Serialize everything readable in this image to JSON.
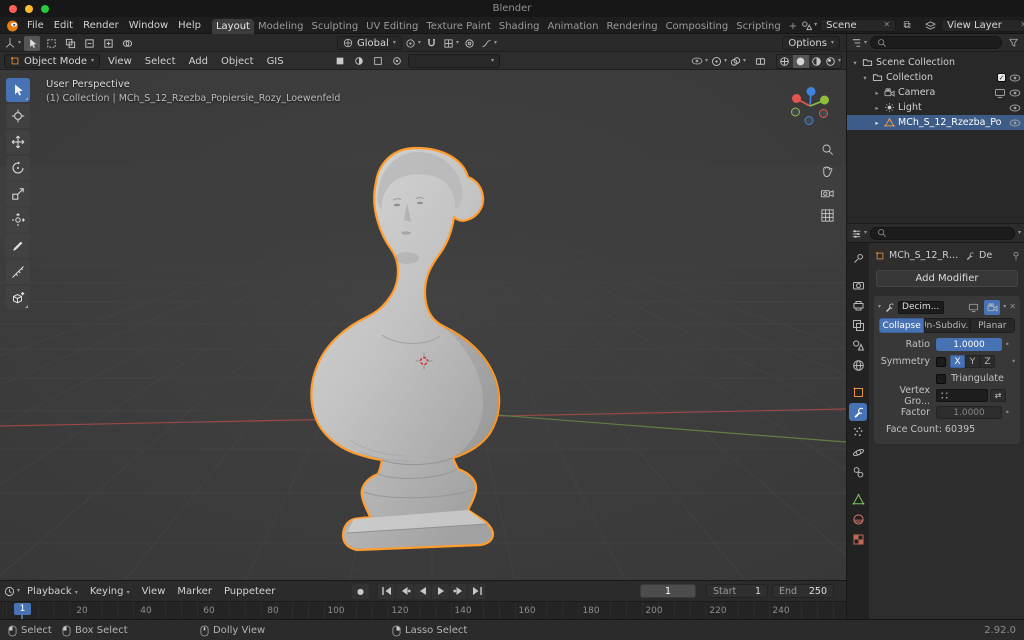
{
  "window": {
    "title": "Blender",
    "version": "2.92.0"
  },
  "glyphs": {
    "caret": "▾",
    "caret_right": "▸",
    "close": "✕",
    "decorator": "•",
    "swap": "⇄",
    "check": "✓",
    "plus": "+",
    "record": "●",
    "copy": "⧉"
  },
  "colors": {
    "accent": "#4772b3",
    "selection_outline": "#ff9d2e",
    "axis_x": "#9a4848",
    "axis_y": "#5f7f45"
  },
  "topbar": {
    "menus": [
      "File",
      "Edit",
      "Render",
      "Window",
      "Help"
    ],
    "workspaces": [
      "Layout",
      "Modeling",
      "Sculpting",
      "UV Editing",
      "Texture Paint",
      "Shading",
      "Animation",
      "Rendering",
      "Compositing",
      "Scripting"
    ],
    "add_workspace": "+",
    "scene_value": "Scene",
    "view_layer_value": "View Layer"
  },
  "tool_settings": {
    "orientation": "Global",
    "options": "Options"
  },
  "viewport_header": {
    "mode": "Object Mode",
    "menus": [
      "View",
      "Select",
      "Add",
      "Object",
      "GIS"
    ]
  },
  "viewport": {
    "view_label": "User Perspective",
    "context_label": "(1) Collection | MCh_S_12_Rzezba_Popiersie_Rozy_Loewenfeld"
  },
  "outliner": {
    "items": [
      {
        "label": "Scene Collection"
      },
      {
        "label": "Collection"
      },
      {
        "label": "Camera"
      },
      {
        "label": "Light"
      },
      {
        "label": "MCh_S_12_Rzezba_Po"
      }
    ]
  },
  "properties": {
    "breadcrumb_object": "MCh_S_12_Rz...",
    "breadcrumb_modifier": "De",
    "add_modifier": "Add Modifier",
    "modifier": {
      "name": "Decim...",
      "tabs": [
        "Collapse",
        "Un-Subdiv...",
        "Planar"
      ],
      "ratio_label": "Ratio",
      "ratio_value": "1.0000",
      "symmetry_label": "Symmetry",
      "axis_x": "X",
      "axis_y": "Y",
      "axis_z": "Z",
      "triangulate_label": "Triangulate",
      "vertex_group_label": "Vertex Gro...",
      "factor_label": "Factor",
      "factor_value": "1.0000",
      "face_count": "Face Count: 60395"
    }
  },
  "timeline": {
    "menus": [
      "Playback",
      "Keying",
      "View",
      "Marker",
      "Puppeteer"
    ],
    "current_frame": "1",
    "frame_field": "1",
    "start_label": "Start",
    "start_value": "1",
    "end_label": "End",
    "end_value": "250",
    "ticks": [
      "20",
      "40",
      "60",
      "80",
      "100",
      "120",
      "140",
      "160",
      "180",
      "200",
      "220",
      "240"
    ]
  },
  "statusbar": {
    "select": "Select",
    "box_select": "Box Select",
    "dolly": "Dolly View",
    "lasso": "Lasso Select"
  }
}
